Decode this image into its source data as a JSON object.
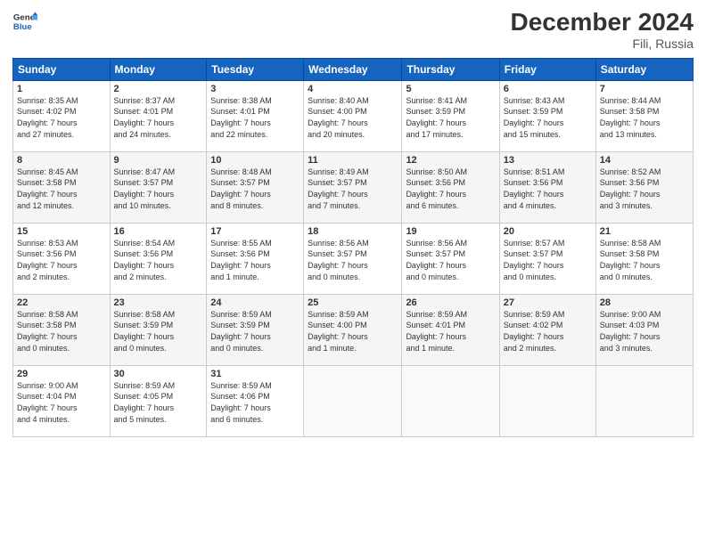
{
  "header": {
    "logo_line1": "General",
    "logo_line2": "Blue",
    "month_title": "December 2024",
    "location": "Fili, Russia"
  },
  "weekdays": [
    "Sunday",
    "Monday",
    "Tuesday",
    "Wednesday",
    "Thursday",
    "Friday",
    "Saturday"
  ],
  "weeks": [
    [
      {
        "day": "1",
        "sunrise": "8:35 AM",
        "sunset": "4:02 PM",
        "daylight": "7 hours and 27 minutes."
      },
      {
        "day": "2",
        "sunrise": "8:37 AM",
        "sunset": "4:01 PM",
        "daylight": "7 hours and 24 minutes."
      },
      {
        "day": "3",
        "sunrise": "8:38 AM",
        "sunset": "4:01 PM",
        "daylight": "7 hours and 22 minutes."
      },
      {
        "day": "4",
        "sunrise": "8:40 AM",
        "sunset": "4:00 PM",
        "daylight": "7 hours and 20 minutes."
      },
      {
        "day": "5",
        "sunrise": "8:41 AM",
        "sunset": "3:59 PM",
        "daylight": "7 hours and 17 minutes."
      },
      {
        "day": "6",
        "sunrise": "8:43 AM",
        "sunset": "3:59 PM",
        "daylight": "7 hours and 15 minutes."
      },
      {
        "day": "7",
        "sunrise": "8:44 AM",
        "sunset": "3:58 PM",
        "daylight": "7 hours and 13 minutes."
      }
    ],
    [
      {
        "day": "8",
        "sunrise": "8:45 AM",
        "sunset": "3:58 PM",
        "daylight": "7 hours and 12 minutes."
      },
      {
        "day": "9",
        "sunrise": "8:47 AM",
        "sunset": "3:57 PM",
        "daylight": "7 hours and 10 minutes."
      },
      {
        "day": "10",
        "sunrise": "8:48 AM",
        "sunset": "3:57 PM",
        "daylight": "7 hours and 8 minutes."
      },
      {
        "day": "11",
        "sunrise": "8:49 AM",
        "sunset": "3:57 PM",
        "daylight": "7 hours and 7 minutes."
      },
      {
        "day": "12",
        "sunrise": "8:50 AM",
        "sunset": "3:56 PM",
        "daylight": "7 hours and 6 minutes."
      },
      {
        "day": "13",
        "sunrise": "8:51 AM",
        "sunset": "3:56 PM",
        "daylight": "7 hours and 4 minutes."
      },
      {
        "day": "14",
        "sunrise": "8:52 AM",
        "sunset": "3:56 PM",
        "daylight": "7 hours and 3 minutes."
      }
    ],
    [
      {
        "day": "15",
        "sunrise": "8:53 AM",
        "sunset": "3:56 PM",
        "daylight": "7 hours and 2 minutes."
      },
      {
        "day": "16",
        "sunrise": "8:54 AM",
        "sunset": "3:56 PM",
        "daylight": "7 hours and 2 minutes."
      },
      {
        "day": "17",
        "sunrise": "8:55 AM",
        "sunset": "3:56 PM",
        "daylight": "7 hours and 1 minute."
      },
      {
        "day": "18",
        "sunrise": "8:56 AM",
        "sunset": "3:57 PM",
        "daylight": "7 hours and 0 minutes."
      },
      {
        "day": "19",
        "sunrise": "8:56 AM",
        "sunset": "3:57 PM",
        "daylight": "7 hours and 0 minutes."
      },
      {
        "day": "20",
        "sunrise": "8:57 AM",
        "sunset": "3:57 PM",
        "daylight": "7 hours and 0 minutes."
      },
      {
        "day": "21",
        "sunrise": "8:58 AM",
        "sunset": "3:58 PM",
        "daylight": "7 hours and 0 minutes."
      }
    ],
    [
      {
        "day": "22",
        "sunrise": "8:58 AM",
        "sunset": "3:58 PM",
        "daylight": "7 hours and 0 minutes."
      },
      {
        "day": "23",
        "sunrise": "8:58 AM",
        "sunset": "3:59 PM",
        "daylight": "7 hours and 0 minutes."
      },
      {
        "day": "24",
        "sunrise": "8:59 AM",
        "sunset": "3:59 PM",
        "daylight": "7 hours and 0 minutes."
      },
      {
        "day": "25",
        "sunrise": "8:59 AM",
        "sunset": "4:00 PM",
        "daylight": "7 hours and 1 minute."
      },
      {
        "day": "26",
        "sunrise": "8:59 AM",
        "sunset": "4:01 PM",
        "daylight": "7 hours and 1 minute."
      },
      {
        "day": "27",
        "sunrise": "8:59 AM",
        "sunset": "4:02 PM",
        "daylight": "7 hours and 2 minutes."
      },
      {
        "day": "28",
        "sunrise": "9:00 AM",
        "sunset": "4:03 PM",
        "daylight": "7 hours and 3 minutes."
      }
    ],
    [
      {
        "day": "29",
        "sunrise": "9:00 AM",
        "sunset": "4:04 PM",
        "daylight": "7 hours and 4 minutes."
      },
      {
        "day": "30",
        "sunrise": "8:59 AM",
        "sunset": "4:05 PM",
        "daylight": "7 hours and 5 minutes."
      },
      {
        "day": "31",
        "sunrise": "8:59 AM",
        "sunset": "4:06 PM",
        "daylight": "7 hours and 6 minutes."
      },
      null,
      null,
      null,
      null
    ]
  ],
  "labels": {
    "sunrise": "Sunrise:",
    "sunset": "Sunset:",
    "daylight": "Daylight hours"
  }
}
